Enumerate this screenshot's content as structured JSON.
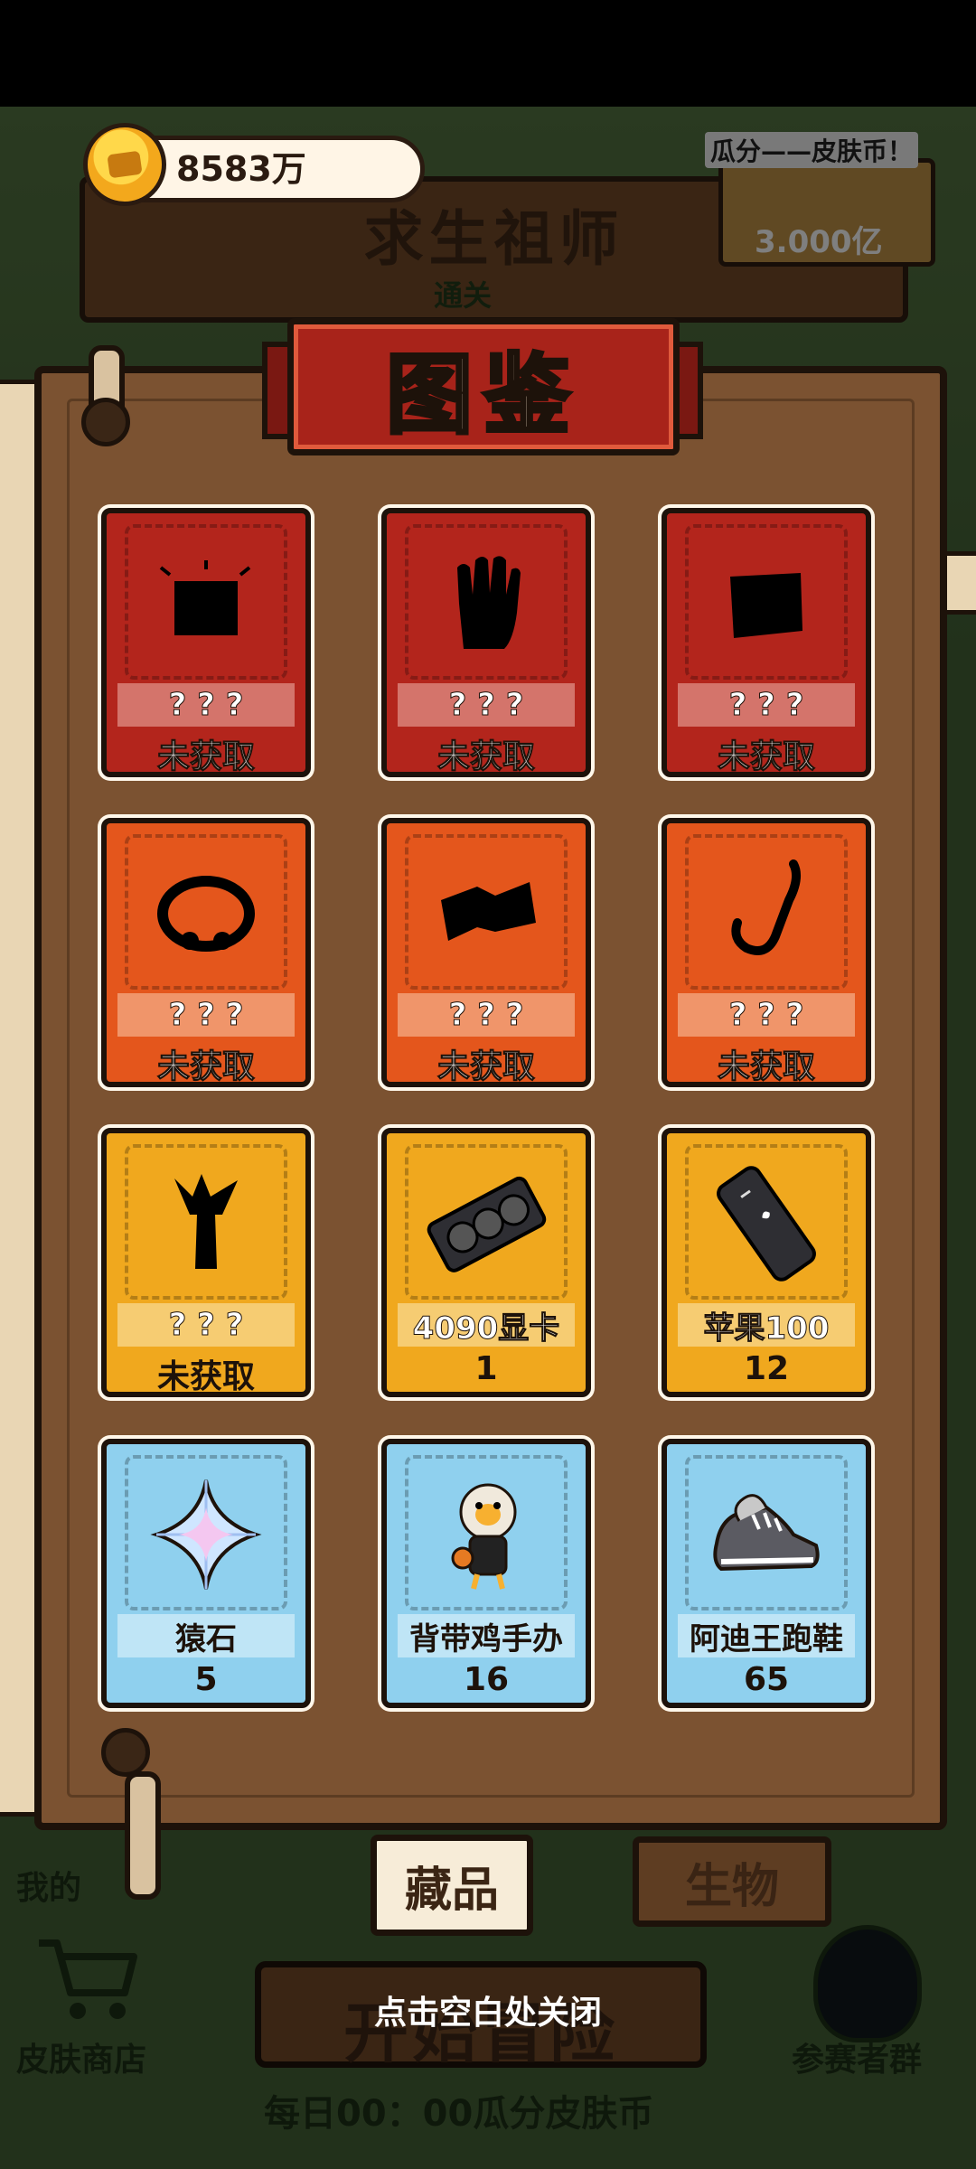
{
  "top": {
    "coins": "8583万",
    "promo": "瓜分",
    "promo_suffix": "皮肤币！",
    "chest_amount": "3.000亿",
    "bg_title": "求生祖师",
    "bg_sub": "通关"
  },
  "panel": {
    "title": "图鉴"
  },
  "cards": [
    {
      "name": "? ? ?",
      "count": "未获取",
      "rarity": "red",
      "icon": "box-silhouette-icon"
    },
    {
      "name": "? ? ?",
      "count": "未获取",
      "rarity": "red",
      "icon": "glove-silhouette-icon"
    },
    {
      "name": "? ? ?",
      "count": "未获取",
      "rarity": "red",
      "icon": "brick-silhouette-icon"
    },
    {
      "name": "? ? ?",
      "count": "未获取",
      "rarity": "orange",
      "icon": "ring-silhouette-icon"
    },
    {
      "name": "? ? ?",
      "count": "未获取",
      "rarity": "orange",
      "icon": "cloth-silhouette-icon"
    },
    {
      "name": "? ? ?",
      "count": "未获取",
      "rarity": "orange",
      "icon": "hook-silhouette-icon"
    },
    {
      "name": "? ? ?",
      "count": "未获取",
      "rarity": "gold",
      "icon": "torch-silhouette-icon"
    },
    {
      "name": "4090显卡",
      "count": "1",
      "rarity": "gold",
      "icon": "graphics-card-icon"
    },
    {
      "name": "苹果100",
      "count": "12",
      "rarity": "gold",
      "icon": "phone-icon"
    },
    {
      "name": "猿石",
      "count": "5",
      "rarity": "blue",
      "icon": "crystal-star-icon"
    },
    {
      "name": "背带鸡手办",
      "count": "16",
      "rarity": "blue",
      "icon": "chicken-figure-icon"
    },
    {
      "name": "阿迪王跑鞋",
      "count": "65",
      "rarity": "blue",
      "icon": "sneaker-icon"
    }
  ],
  "tabs": {
    "collection": "藏品",
    "creatures": "生物"
  },
  "bottom": {
    "start_button": "开始冒险",
    "close_hint": "点击空白处关闭",
    "daily": "每日00：00瓜分皮肤币",
    "skin_shop": "皮肤商店",
    "participants": "参赛者群",
    "my": "我的"
  },
  "colors": {
    "red": "#b3251c",
    "orange": "#e4561c",
    "gold": "#f0a81e",
    "blue": "#8fd0ee",
    "board": "#7b5231"
  }
}
